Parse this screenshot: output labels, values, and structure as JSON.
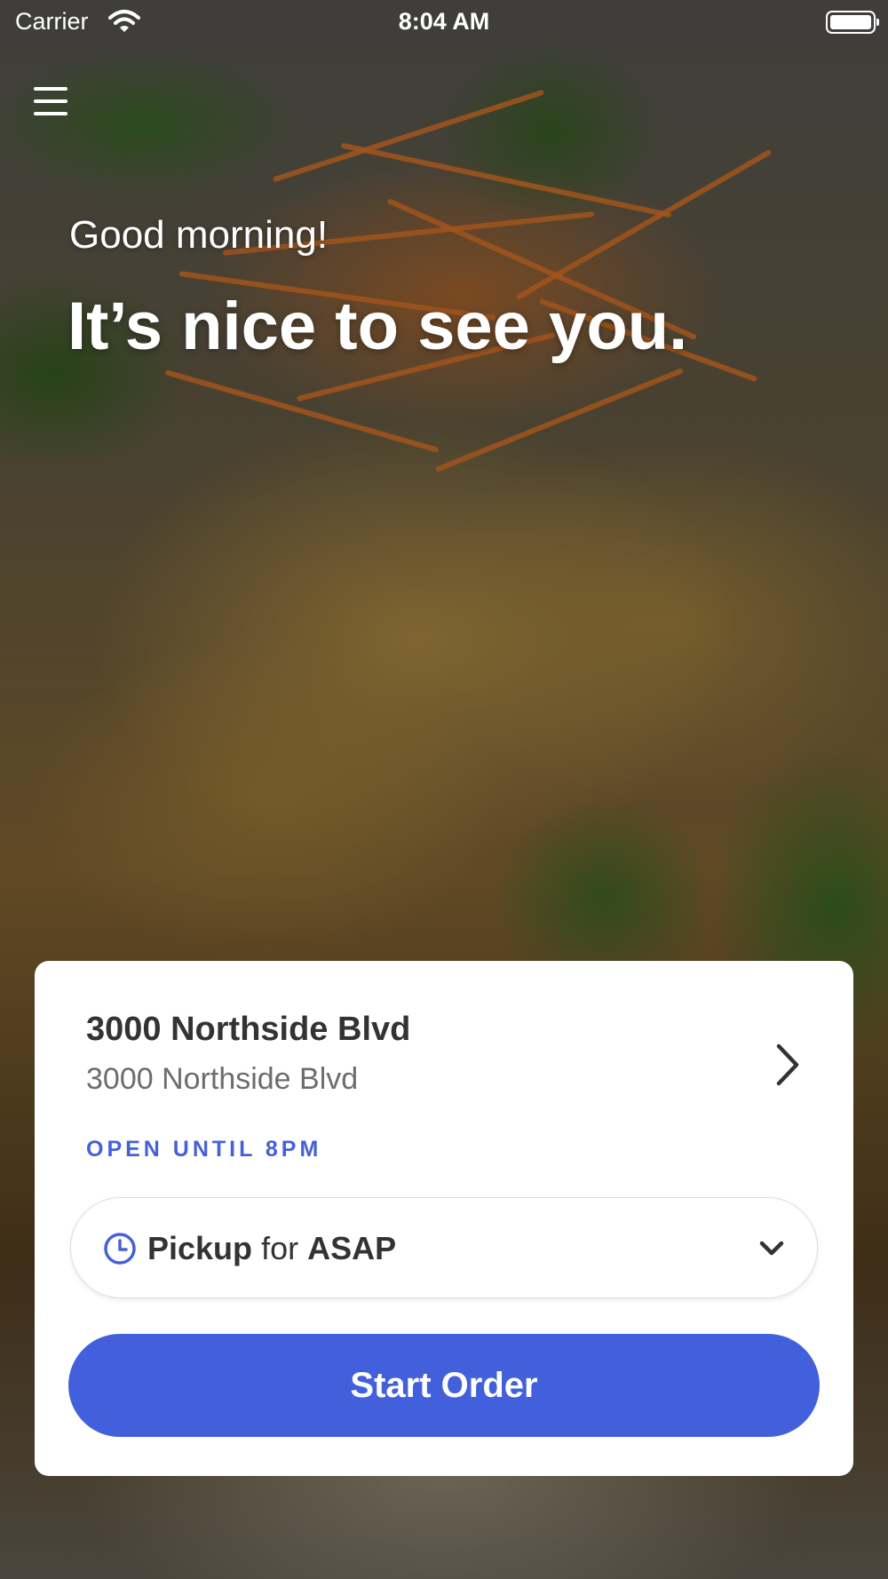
{
  "status_bar": {
    "carrier": "Carrier",
    "time": "8:04 AM"
  },
  "hero": {
    "greeting": "Good morning!",
    "headline": "It’s nice to see you."
  },
  "location_card": {
    "name": "3000 Northside Blvd",
    "address": "3000 Northside Blvd",
    "hours": "OPEN UNTIL 8PM",
    "pickup": {
      "mode": "Pickup",
      "connector": "for",
      "time": "ASAP"
    },
    "start_button_label": "Start Order"
  },
  "icons": {
    "menu": "hamburger-menu-icon",
    "chevron": "chevron-right-icon",
    "clock": "clock-icon",
    "caret": "chevron-down-icon"
  },
  "colors": {
    "accent": "#4260dc",
    "hours_text": "#4561d8",
    "card_background": "#ffffff"
  }
}
